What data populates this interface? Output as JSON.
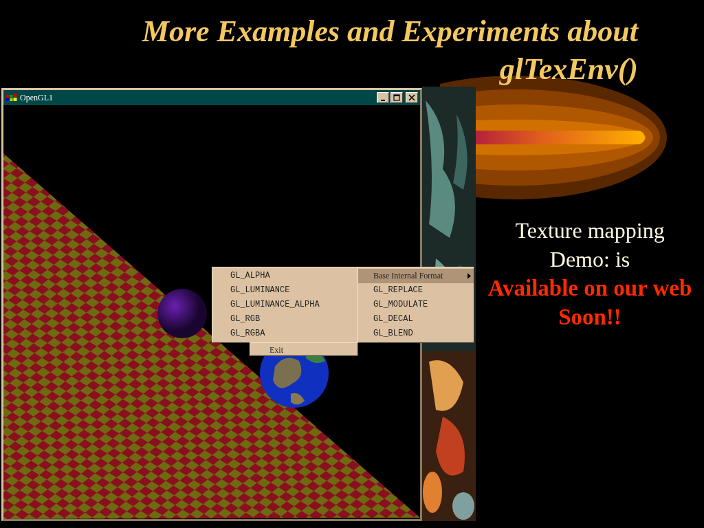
{
  "slide": {
    "title": "More Examples and Experiments about glTexEnv()",
    "text_lines": [
      {
        "text": "Texture mapping",
        "kind": "plain"
      },
      {
        "text": "Demo: is",
        "kind": "plain"
      },
      {
        "text": "Available on our web",
        "kind": "highlight"
      },
      {
        "text": "Soon!!",
        "kind": "highlight"
      }
    ]
  },
  "window": {
    "title": "OpenGL1"
  },
  "submenu": {
    "items": [
      {
        "label": "GL_ALPHA"
      },
      {
        "label": "GL_LUMINANCE"
      },
      {
        "label": "GL_LUMINANCE_ALPHA"
      },
      {
        "label": "GL_RGB"
      },
      {
        "label": "GL_RGBA"
      }
    ]
  },
  "main_menu": {
    "items": [
      {
        "label": "Base Internal Format",
        "selected": true,
        "has_submenu": true
      },
      {
        "label": "GL_REPLACE",
        "selected": false
      },
      {
        "label": "GL_MODULATE",
        "selected": false
      },
      {
        "label": "GL_DECAL",
        "selected": false
      },
      {
        "label": "GL_BLEND",
        "selected": false
      }
    ]
  },
  "exit_menu": {
    "label": "Exit"
  }
}
